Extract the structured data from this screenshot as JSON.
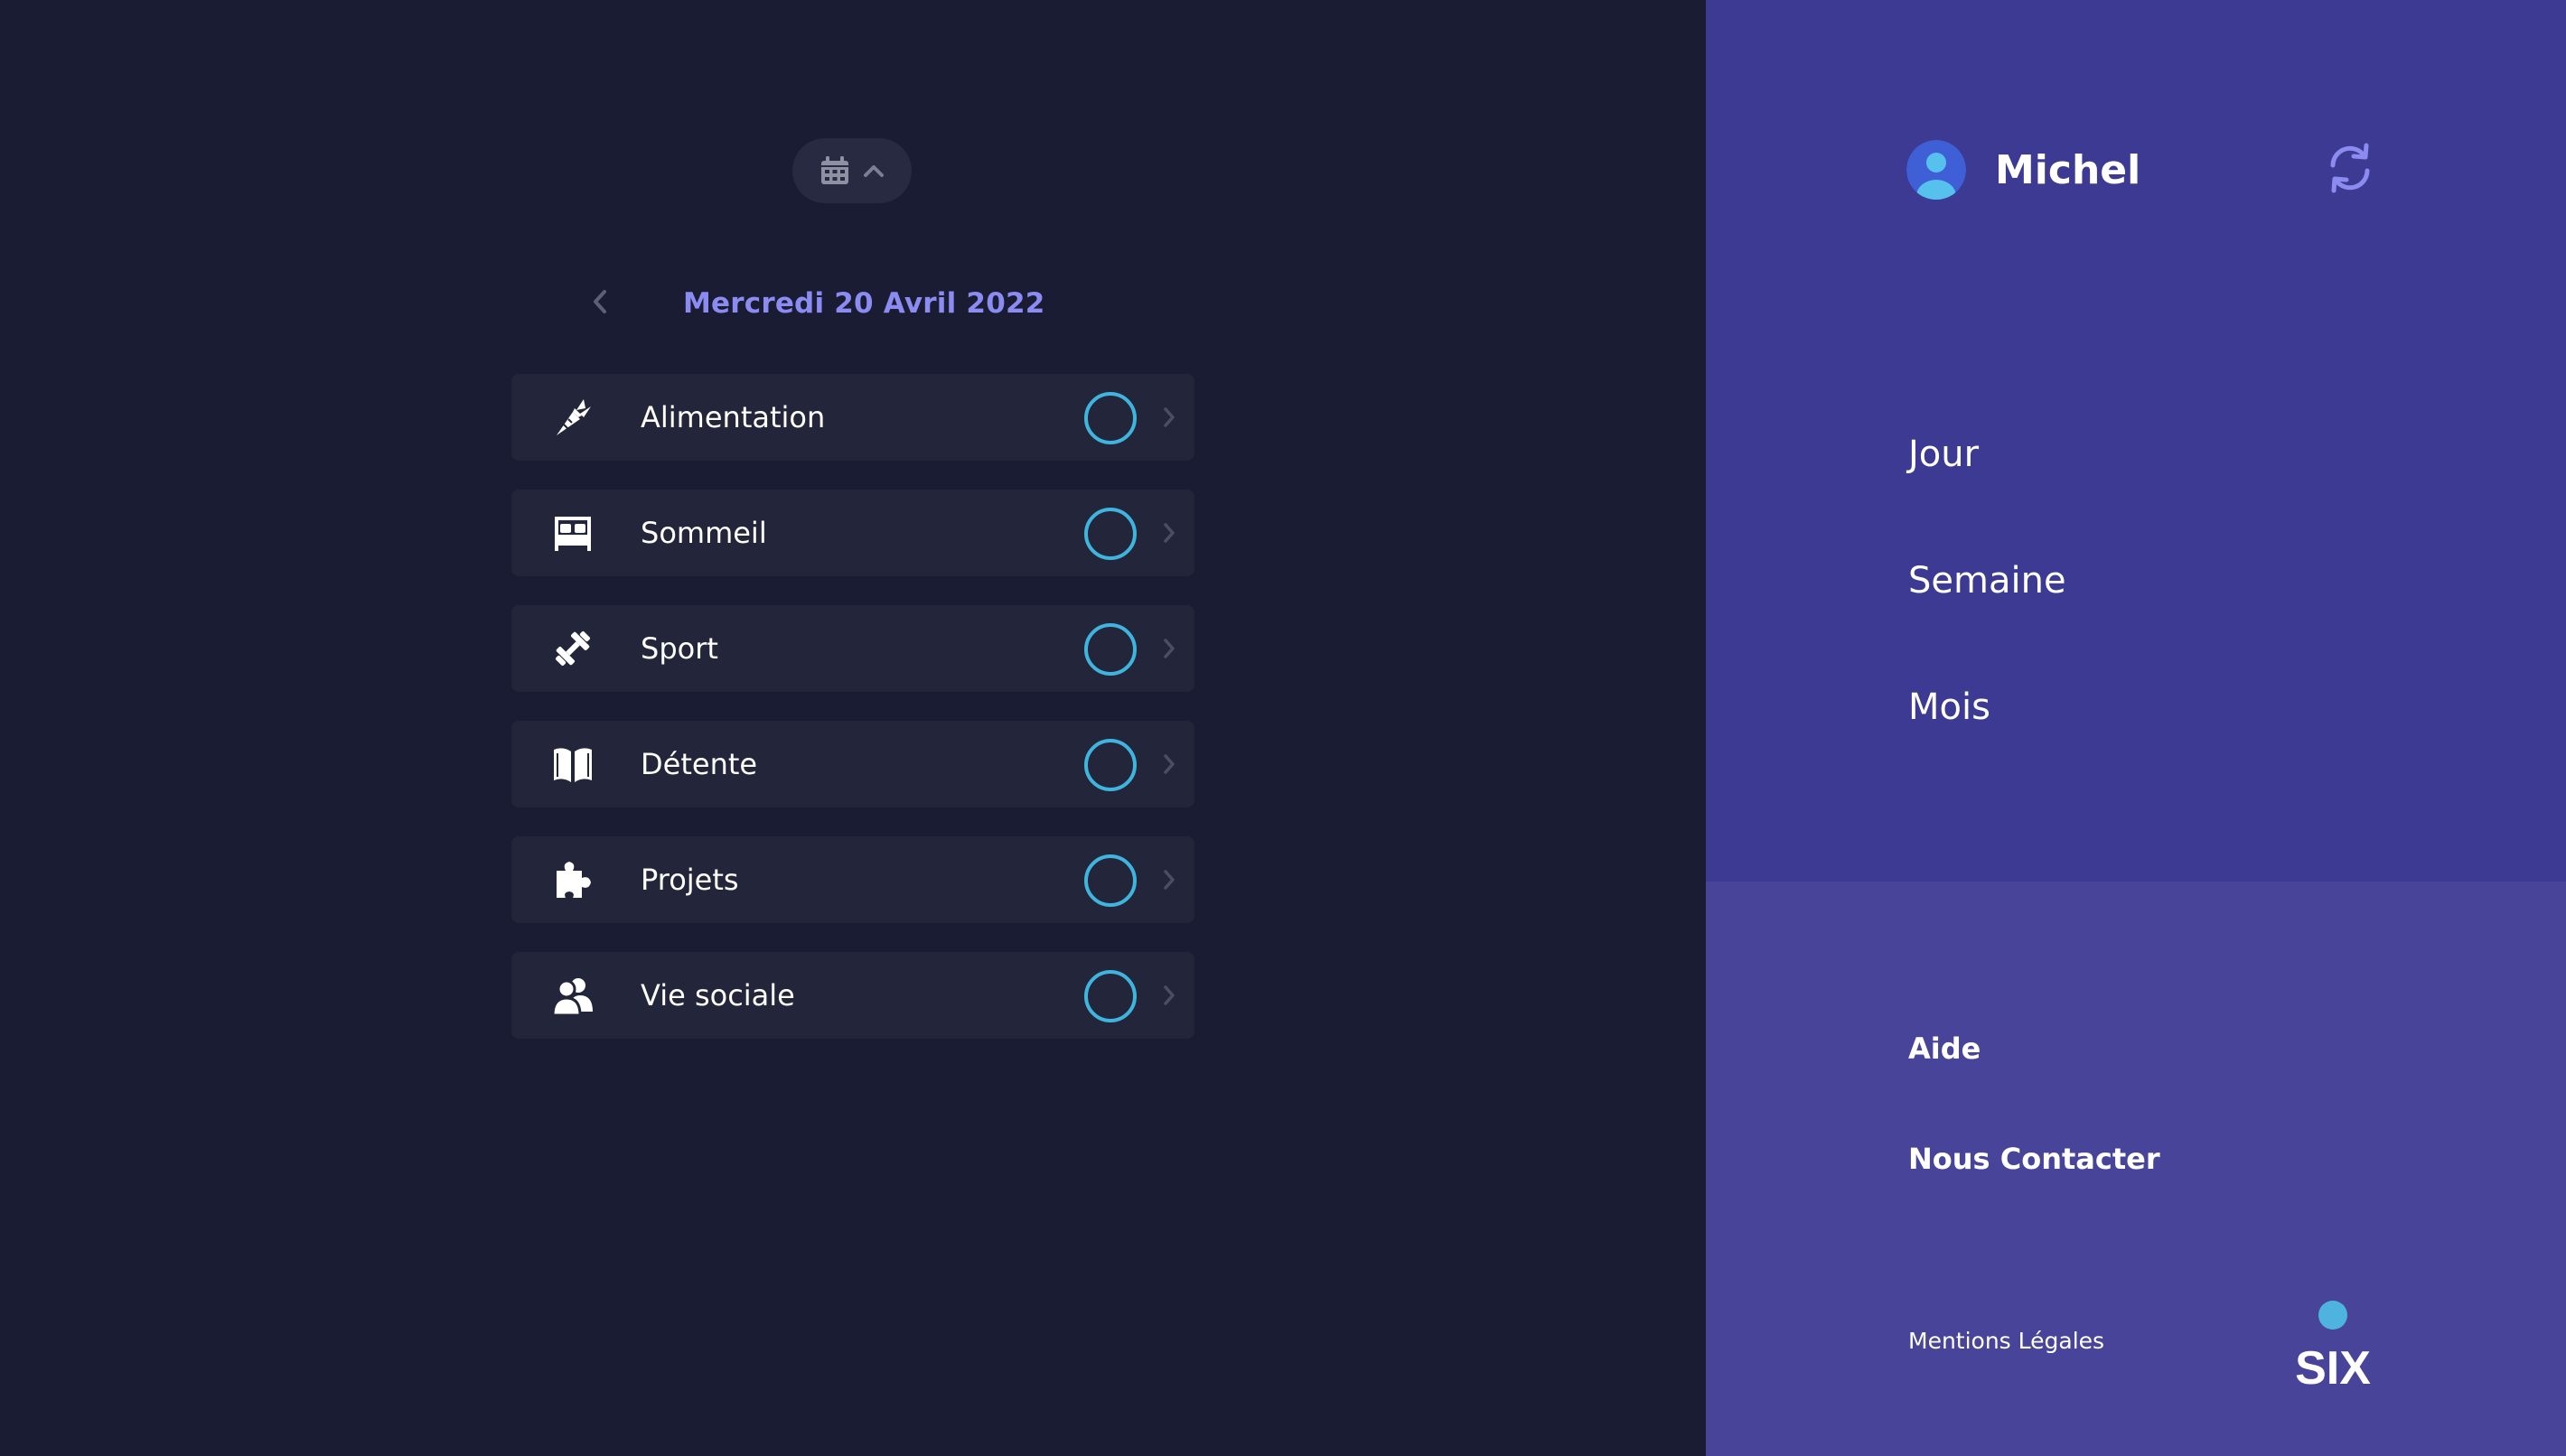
{
  "header": {
    "calendar_icon": "calendar-icon",
    "toggle_icon": "chevron-up-icon"
  },
  "date_nav": {
    "prev_icon": "chevron-left-icon",
    "date_label": "Mercredi 20 Avril 2022"
  },
  "categories": [
    {
      "label": "Alimentation",
      "icon": "carrot-icon",
      "checked": false
    },
    {
      "label": "Sommeil",
      "icon": "bed-icon",
      "checked": false
    },
    {
      "label": "Sport",
      "icon": "dumbbell-icon",
      "checked": false
    },
    {
      "label": "Détente",
      "icon": "book-icon",
      "checked": false
    },
    {
      "label": "Projets",
      "icon": "puzzle-icon",
      "checked": false
    },
    {
      "label": "Vie sociale",
      "icon": "users-icon",
      "checked": false
    }
  ],
  "sidebar": {
    "user_name": "Michel",
    "refresh_icon": "refresh-icon",
    "nav": [
      "Jour",
      "Semaine",
      "Mois"
    ],
    "links": [
      "Aide",
      "Nous Contacter"
    ],
    "legal": "Mentions Légales",
    "logo_text": "SIX"
  },
  "colors": {
    "background": "#1a1c33",
    "card": "#23263b",
    "accent_date": "#8b8bf2",
    "check_ring": "#3fb4dc",
    "sidebar_top": "#3c3a92",
    "sidebar_bottom": "#47449a"
  }
}
